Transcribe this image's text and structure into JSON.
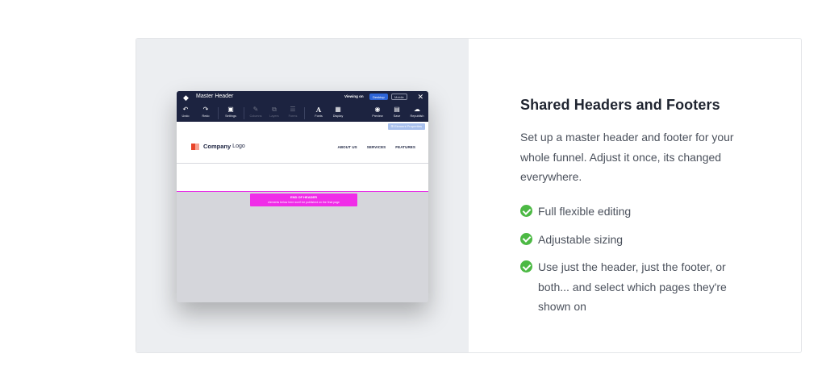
{
  "editor": {
    "title": "Master Header",
    "viewing_on": "Viewing on",
    "view_desktop": "Desktop",
    "view_mobile": "Mobile",
    "close": "✕",
    "tools": {
      "undo": "Undo",
      "redo": "Redo",
      "settings": "Settings",
      "publish": "Columns",
      "layers": "Layers",
      "forms": "Forms",
      "fonts": "Fonts",
      "display": "Display",
      "preview": "Preview",
      "save": "Save",
      "republish": "Republish"
    },
    "element_properties": "⊞ Element Properties",
    "brand_company": "Company",
    "brand_logo": "Logo",
    "nav": [
      "ABOUT US",
      "SERVICES",
      "FEATURES"
    ],
    "end_header_title": "END OF HEADER",
    "end_header_sub": "elements below here won't be published on the final page"
  },
  "content": {
    "heading": "Shared Headers and Footers",
    "description": "Set up a master header and footer for your whole funnel. Adjust it once, its changed everywhere.",
    "features": [
      "Full flexible editing",
      "Adjustable sizing",
      "Use just the header, just the footer, or both... and select which pages they're shown on"
    ]
  },
  "colors": {
    "check": "#4cb944",
    "editor_bar": "#1c2340",
    "end_tag": "#f02de8"
  }
}
